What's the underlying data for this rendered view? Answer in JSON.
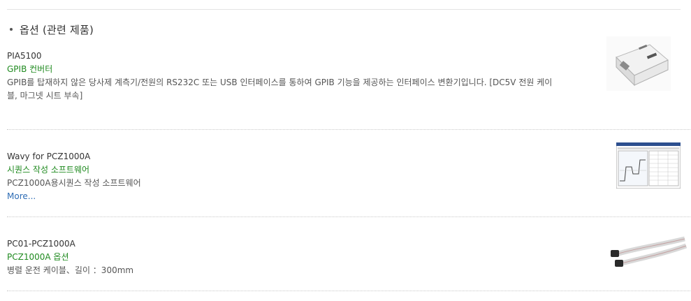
{
  "section": {
    "title": "옵션 (관련 제품)"
  },
  "products": [
    {
      "name": "PIA5100",
      "category": "GPIB 컨버터",
      "description": "GPIB를 탑재하지 않은 당사제 계측기/전원의 RS232C 또는 USB 인터페이스를 통하여 GPIB 기능을 제공하는 인터페이스 변환기입니다. [DC5V 전원 케이블, 마그넷 시트 부속]",
      "image_icon": "interface-converter-device"
    },
    {
      "name": "Wavy for PCZ1000A",
      "category": "시퀀스 작성 소프트웨어",
      "description": "PCZ1000A용시퀀스 작성 소프트웨어",
      "more": "More...",
      "image_icon": "software-screenshot"
    },
    {
      "name": "PC01-PCZ1000A",
      "category": "PCZ1000A 옵션",
      "description": "병렬 운전 케이블、길이 ：300mm",
      "image_icon": "ribbon-cable"
    }
  ],
  "colors": {
    "category": "#1f8a1f",
    "link": "#2f6db5",
    "separator": "#c9c9c9"
  }
}
